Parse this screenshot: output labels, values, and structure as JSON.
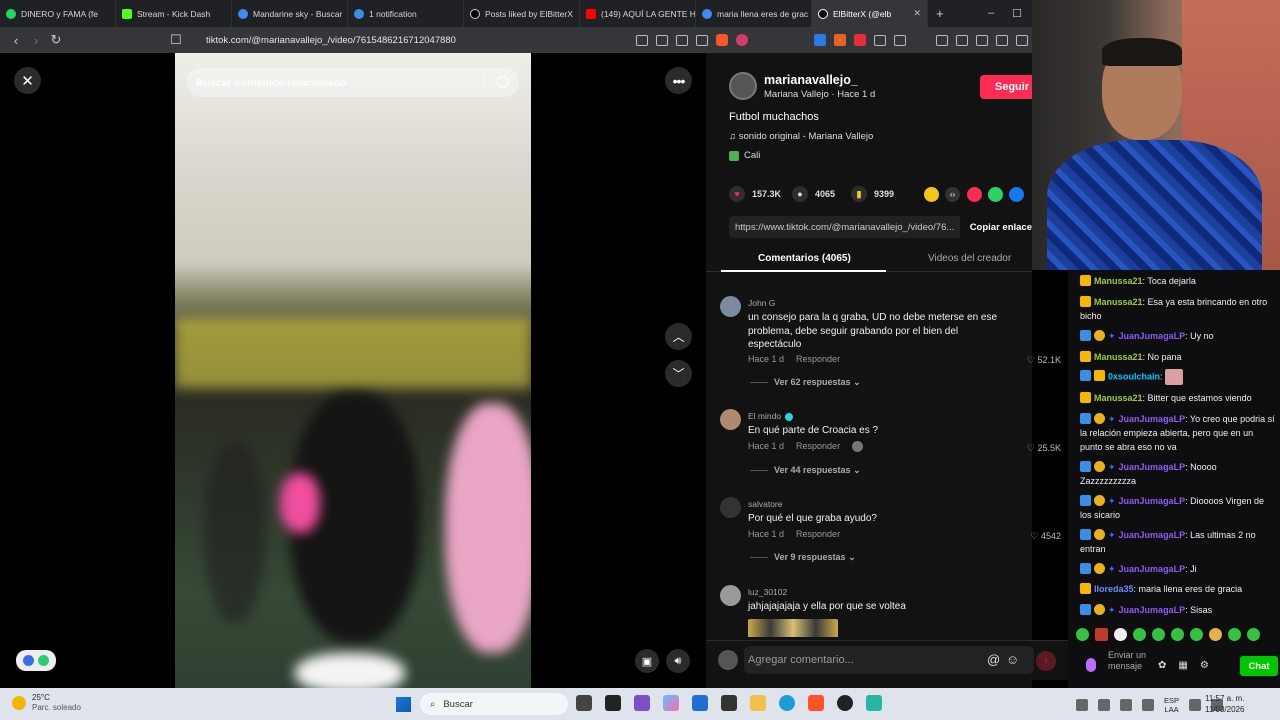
{
  "browser": {
    "tabs": [
      {
        "label": "DINERO y FAMA (fe",
        "color": "#1ed760"
      },
      {
        "label": "Stream - Kick Dash",
        "color": "#53fc18"
      },
      {
        "label": "Mandarine sky - Buscar",
        "color": "#4285f4"
      },
      {
        "label": "1 notification",
        "color": "#3a8ee6"
      },
      {
        "label": "Posts liked by ElBitterX",
        "color": "#ffffff"
      },
      {
        "label": "(149) AQUÍ LA GENTE H",
        "color": "#ff0000"
      },
      {
        "label": "maria llena eres de grac",
        "color": "#4285f4"
      },
      {
        "label": "ElBitterX (@elb",
        "color": "#ffffff",
        "active": true
      }
    ],
    "url": "tiktok.com/@marianavallejo_/video/7615486216712047880"
  },
  "video": {
    "search_placeholder": "Buscar contenido relacionado"
  },
  "post": {
    "username": "marianavallejo_",
    "display_name": "Mariana Vallejo · Hace 1 d",
    "follow_label": "Seguir",
    "caption": "Futbol muchachos",
    "sound": "sonido original - Mariana Vallejo",
    "location": "Cali",
    "likes": "157.3K",
    "comments_count": "4065",
    "saves": "9399",
    "link": "https://www.tiktok.com/@marianavallejo_/video/76...",
    "copy_link": "Copiar enlace",
    "tab_comments": "Comentarios (4065)",
    "tab_creator": "Videos del creador"
  },
  "comments": [
    {
      "user": "John G",
      "text": "un consejo para la q graba, UD no debe meterse en ese problema, debe seguir grabando por el bien del espectáculo",
      "time": "Hace 1 d",
      "reply": "Responder",
      "likes": "52.1K",
      "replies": "Ver 62 respuestas"
    },
    {
      "user": "El mindo",
      "text": "En qué parte de Croacia es ?",
      "time": "Hace 1 d",
      "reply": "Responder",
      "likes": "25.5K",
      "replies": "Ver 44 respuestas"
    },
    {
      "user": "salvatore",
      "text": "Por qué el que graba ayudo?",
      "time": "Hace 1 d",
      "reply": "Responder",
      "likes": "4542",
      "replies": "Ver 9 respuestas"
    },
    {
      "user": "luz_30102",
      "text": "jahjajajajaja y ella por que se voltea"
    }
  ],
  "comment_input_placeholder": "Agregar comentario...",
  "chat": {
    "messages": [
      {
        "user": "Manussa21",
        "text": ": Toca dejarla"
      },
      {
        "user": "Manussa21",
        "text": ": Esa ya esta brincando en otro bicho"
      },
      {
        "user": "JuanJumagaLP",
        "text": ": Uy no"
      },
      {
        "user": "Manussa21",
        "text": ": No pana"
      },
      {
        "user": "0xsoulchain",
        "text": ":"
      },
      {
        "user": "Manussa21",
        "text": ": Bitter que estamos viendo"
      },
      {
        "user": "JuanJumagaLP",
        "text": ": Yo creo que podria sí la relación empieza abierta, pero que en un punto se abra eso no va"
      },
      {
        "user": "JuanJumagaLP",
        "text": ": Noooo Zazzzzzzzzza"
      },
      {
        "user": "JuanJumagaLP",
        "text": ": Dioooos Virgen de los sicario"
      },
      {
        "user": "JuanJumagaLP",
        "text": ": Las ultimas 2 no entran"
      },
      {
        "user": "JuanJumagaLP",
        "text": ": Ji"
      },
      {
        "user": "lloreda35",
        "text": ": maria llena eres de gracia"
      },
      {
        "user": "JuanJumagaLP",
        "text": ": Sisas"
      }
    ],
    "input_placeholder": "Enviar un mensaje",
    "chat_button": "Chat"
  },
  "taskbar": {
    "temp": "25°C",
    "weather": "Parc. soleado",
    "search": "Buscar",
    "lang1": "ESP",
    "lang2": "LAA",
    "time": "11:57 a. m.",
    "date": "11/03/2026"
  }
}
